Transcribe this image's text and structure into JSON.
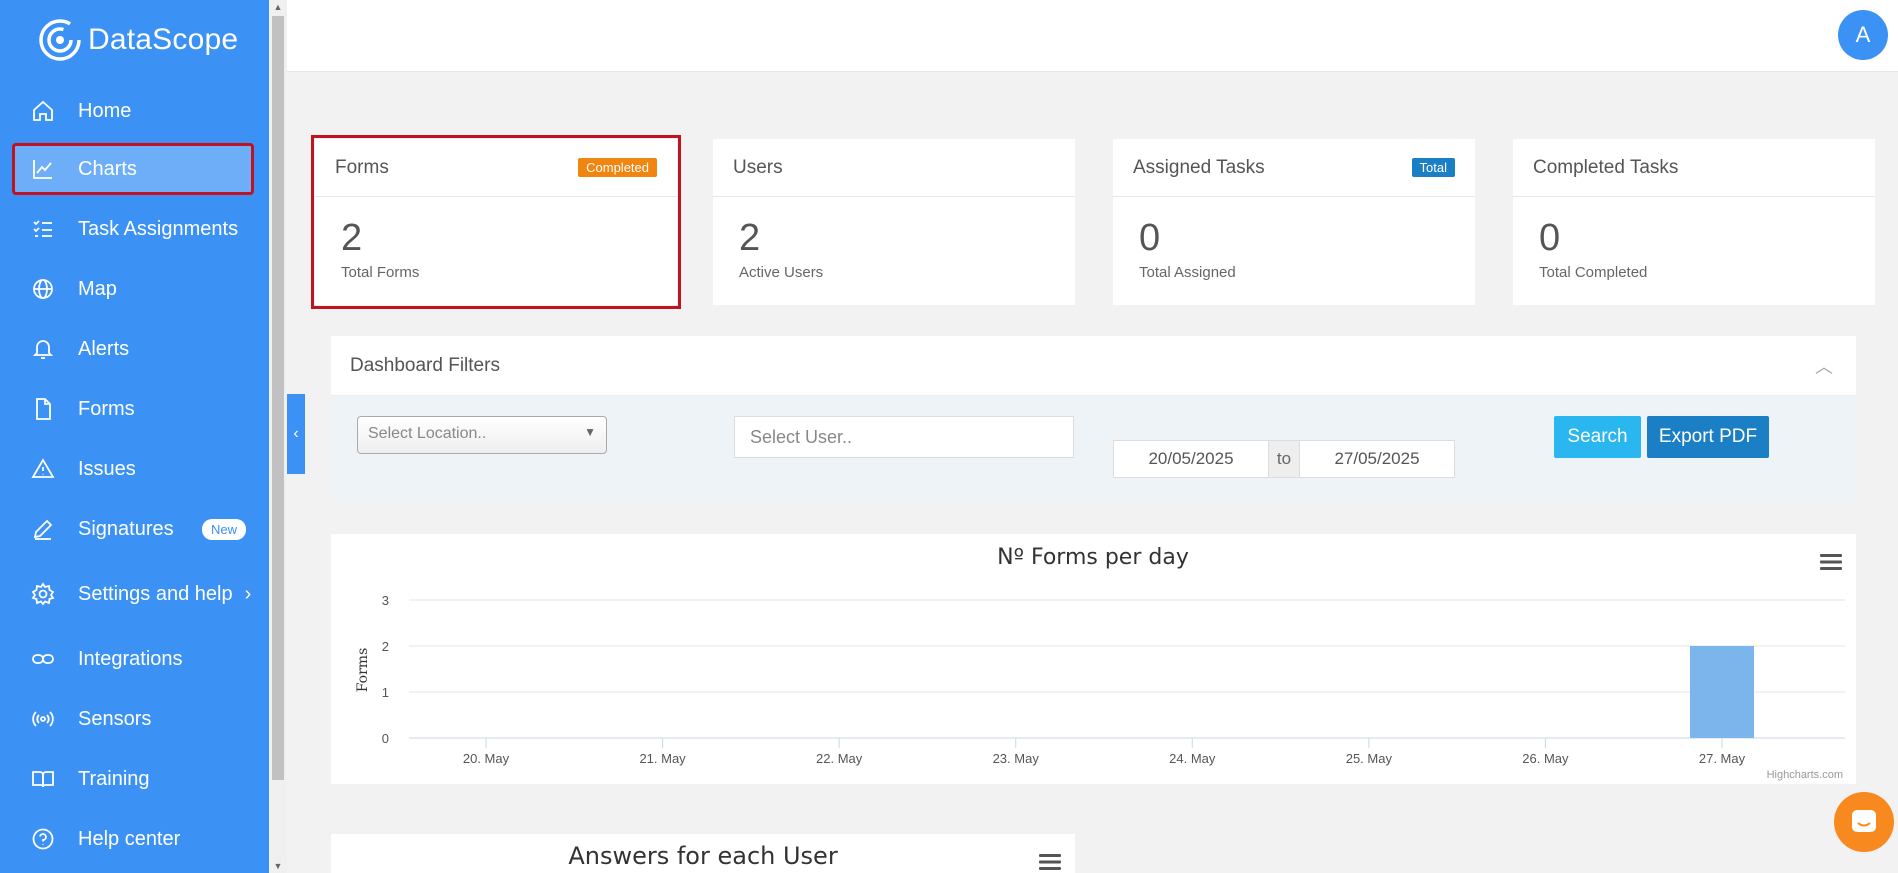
{
  "app": {
    "name": "DataScope",
    "avatar_initial": "A"
  },
  "sidebar": {
    "items": [
      {
        "label": "Home",
        "icon": "home-icon"
      },
      {
        "label": "Charts",
        "icon": "chart-line-icon",
        "active": true
      },
      {
        "label": "Task Assignments",
        "icon": "task-list-icon"
      },
      {
        "label": "Map",
        "icon": "globe-icon"
      },
      {
        "label": "Alerts",
        "icon": "bell-icon"
      },
      {
        "label": "Forms",
        "icon": "file-icon"
      },
      {
        "label": "Issues",
        "icon": "warning-icon"
      },
      {
        "label": "Signatures",
        "icon": "pen-icon",
        "badge": "New"
      },
      {
        "label": "Settings and help",
        "icon": "gear-icon"
      },
      {
        "label": "Integrations",
        "icon": "link-icon"
      },
      {
        "label": "Sensors",
        "icon": "sensor-icon"
      },
      {
        "label": "Training",
        "icon": "book-icon"
      },
      {
        "label": "Help center",
        "icon": "help-icon"
      }
    ]
  },
  "cards": [
    {
      "title": "Forms",
      "badge": "Completed",
      "badge_color": "#f0850f",
      "value": "2",
      "label": "Total Forms"
    },
    {
      "title": "Users",
      "value": "2",
      "label": "Active Users"
    },
    {
      "title": "Assigned Tasks",
      "badge": "Total",
      "badge_color": "#1b7fc6",
      "value": "0",
      "label": "Total Assigned"
    },
    {
      "title": "Completed Tasks",
      "value": "0",
      "label": "Total Completed"
    }
  ],
  "filters": {
    "title": "Dashboard Filters",
    "location_placeholder": "Select Location..",
    "user_placeholder": "Select User..",
    "date_from": "20/05/2025",
    "date_sep": "to",
    "date_to": "27/05/2025",
    "search_label": "Search",
    "export_label": "Export PDF"
  },
  "chart_data": {
    "type": "bar",
    "title": "Nº Forms per day",
    "ylabel": "Forms",
    "xlabel": "",
    "categories": [
      "20. May",
      "21. May",
      "22. May",
      "23. May",
      "24. May",
      "25. May",
      "26. May",
      "27. May"
    ],
    "values": [
      0,
      0,
      0,
      0,
      0,
      0,
      0,
      2
    ],
    "yticks": [
      "0",
      "1",
      "2",
      "3"
    ],
    "ylim": [
      0,
      3
    ],
    "grid": true,
    "bar_color": "#7cb5ec",
    "credits": "Highcharts.com"
  },
  "panel2": {
    "title": "Answers for each User"
  }
}
